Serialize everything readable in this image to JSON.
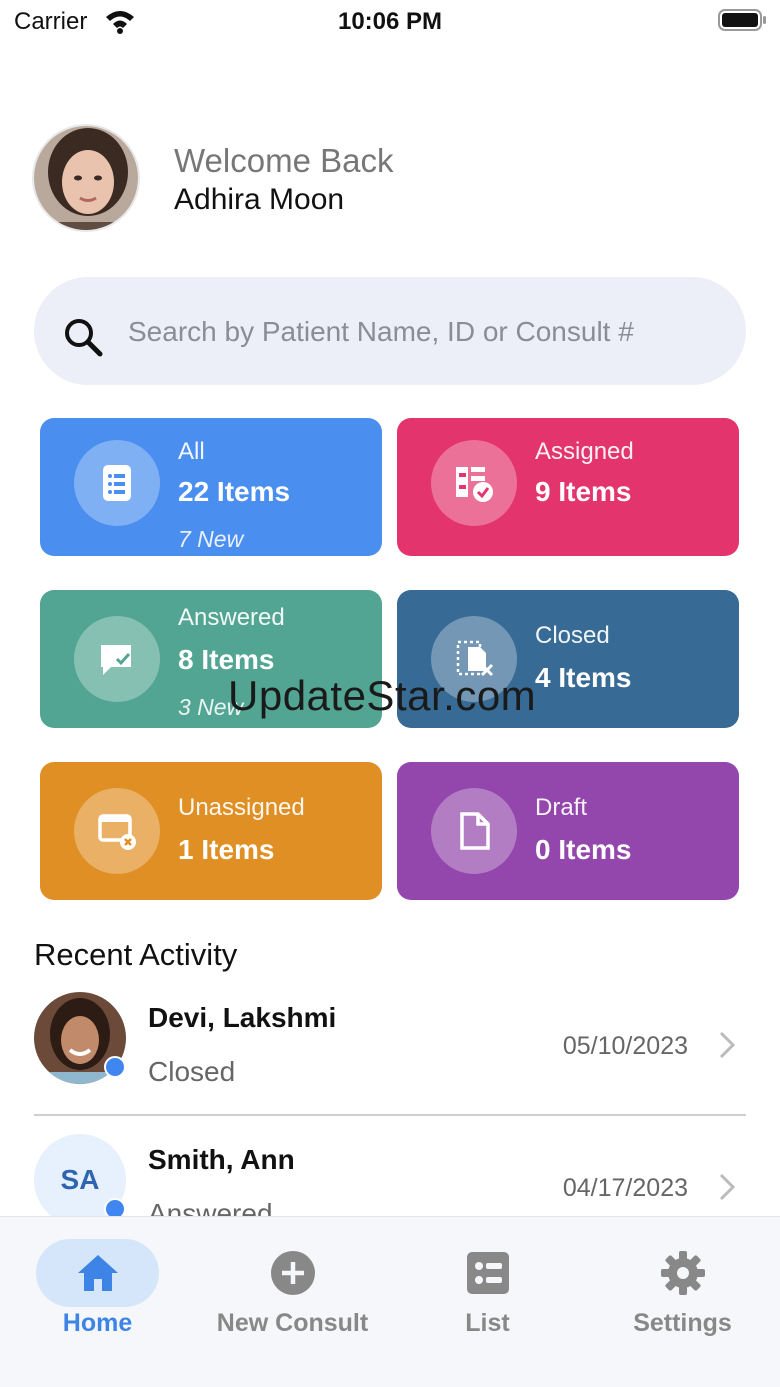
{
  "status_bar": {
    "carrier": "Carrier",
    "time": "10:06 PM"
  },
  "header": {
    "welcome": "Welcome Back",
    "user_name": "Adhira Moon"
  },
  "search": {
    "placeholder": "Search by Patient Name, ID or Consult #",
    "value": ""
  },
  "tiles": [
    {
      "label": "All",
      "count": "22 Items",
      "new": "7 New",
      "color": "#4a8ff0",
      "icon": "list-icon"
    },
    {
      "label": "Assigned",
      "count": "9 Items",
      "color": "#e4346e",
      "icon": "assigned-check-icon"
    },
    {
      "label": "Answered",
      "count": "8 Items",
      "new": "3 New",
      "color": "#52a592",
      "icon": "chat-check-icon"
    },
    {
      "label": "Closed",
      "count": "4 Items",
      "color": "#376a94",
      "icon": "document-close-icon"
    },
    {
      "label": "Unassigned",
      "count": "1 Items",
      "color": "#e08f25",
      "icon": "window-x-icon"
    },
    {
      "label": "Draft",
      "count": "0 Items",
      "color": "#9346ab",
      "icon": "document-icon"
    }
  ],
  "recent": {
    "title": "Recent Activity",
    "items": [
      {
        "name": "Devi, Lakshmi",
        "status": "Closed",
        "date": "05/10/2023"
      },
      {
        "name": "Smith, Ann",
        "initials": "SA",
        "status": "Answered",
        "date": "04/17/2023"
      }
    ]
  },
  "tabbar": {
    "tabs": [
      {
        "label": "Home",
        "icon": "home-icon",
        "active": true
      },
      {
        "label": "New Consult",
        "icon": "plus-circle-icon"
      },
      {
        "label": "List",
        "icon": "list-box-icon"
      },
      {
        "label": "Settings",
        "icon": "gear-icon"
      }
    ]
  },
  "watermark": "UpdateStar.com",
  "colors": {
    "accent": "#3d84e6",
    "status_dot": "#3f86f0"
  }
}
